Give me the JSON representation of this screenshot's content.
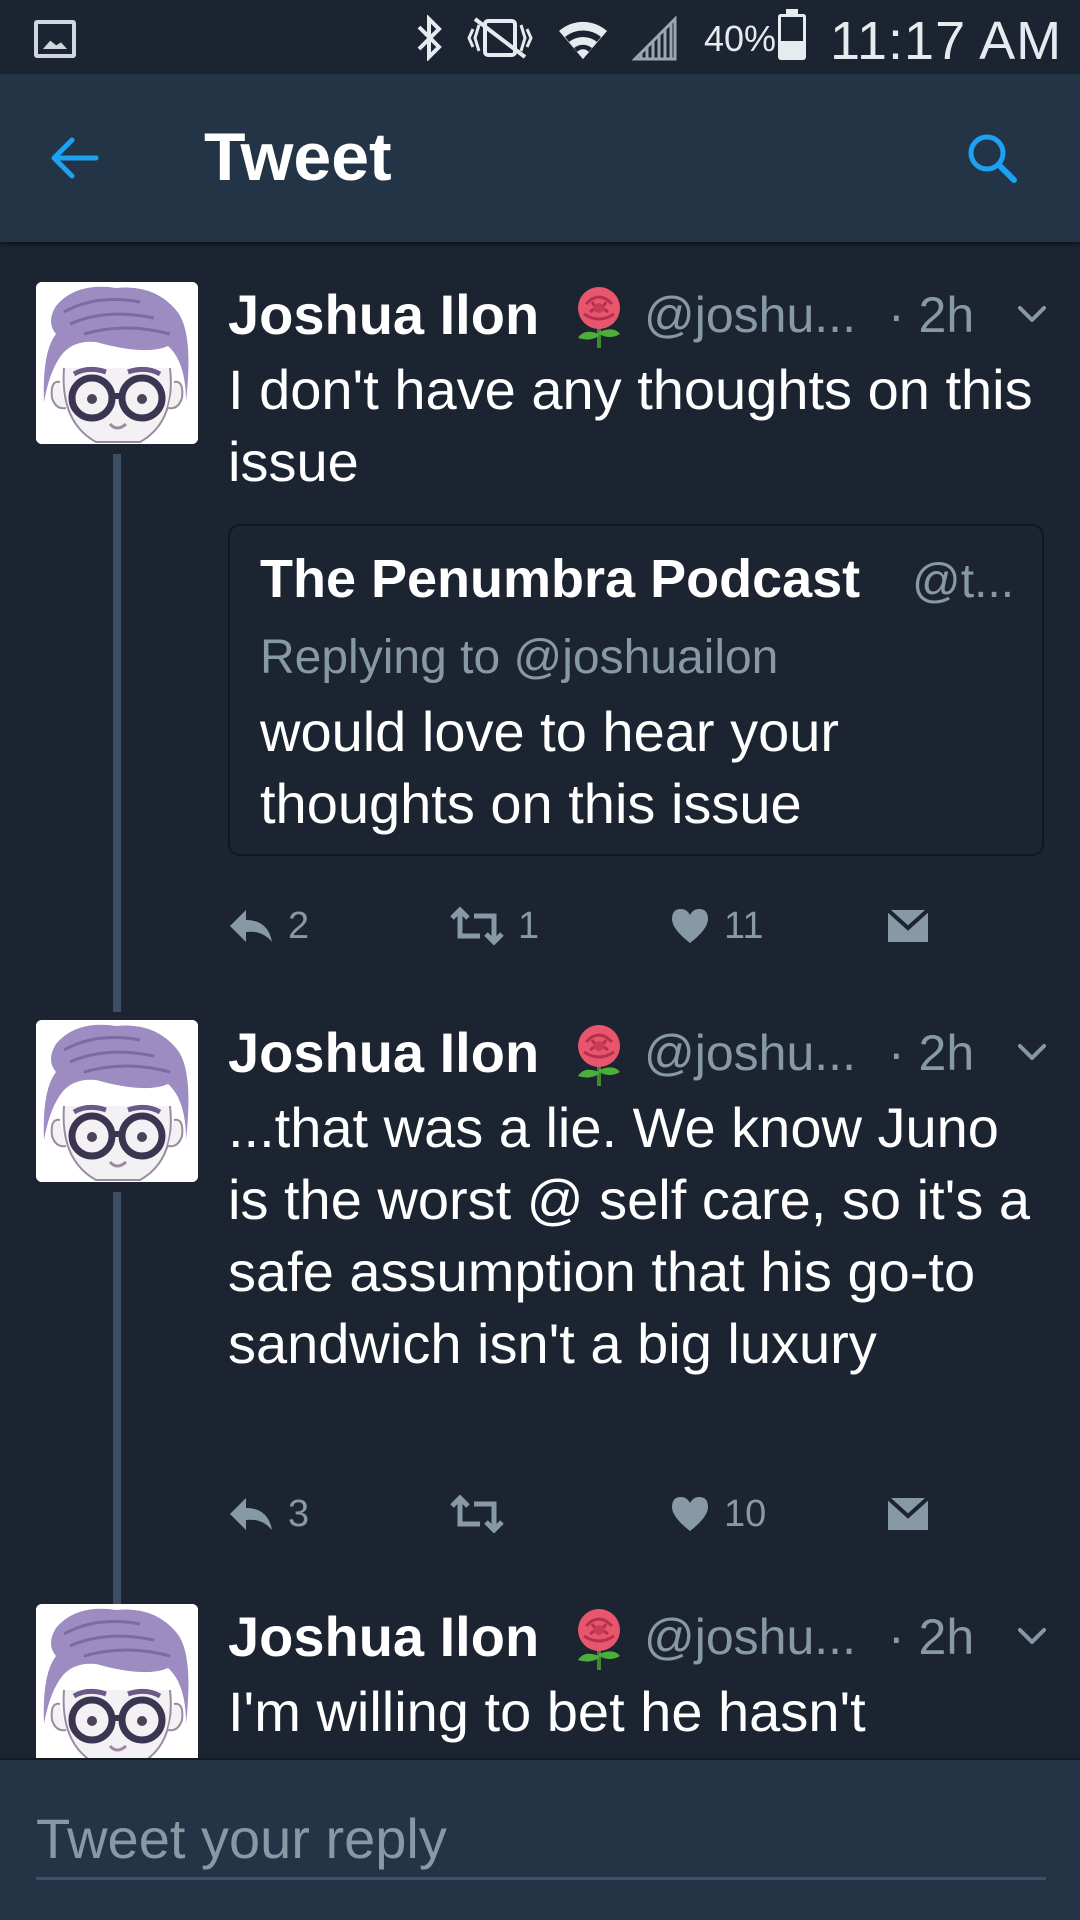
{
  "status_bar": {
    "battery": "40%",
    "time": "11:17 AM",
    "icons": [
      "gallery-icon",
      "bluetooth-icon",
      "vibrate-off-icon",
      "wifi-icon",
      "signal-icon",
      "battery-icon"
    ]
  },
  "header": {
    "title": "Tweet",
    "back_icon": "arrow-left-icon",
    "search_icon": "search-icon"
  },
  "tweets": [
    {
      "name": "Joshua Ilon",
      "handle": "@joshu...",
      "time": "· 2h",
      "text": "I don't have any thoughts on this issue",
      "quote": {
        "name": "The Penumbra Podcast",
        "handle": "@t...",
        "replying_to": "Replying to @joshuailon",
        "text": "would love to hear your thoughts on this issue"
      },
      "replies": "2",
      "retweets": "1",
      "likes": "11"
    },
    {
      "name": "Joshua Ilon",
      "handle": "@joshu...",
      "time": "· 2h",
      "text": "...that was a lie. We know Juno is the worst @ self care, so it's a safe assumption that his go-to sandwich isn't a big luxury",
      "replies": "3",
      "retweets": "",
      "likes": "10"
    },
    {
      "name": "Joshua Ilon",
      "handle": "@joshu...",
      "time": "· 2h",
      "text": "I'm willing to bet he hasn't"
    }
  ],
  "reply": {
    "placeholder": "Tweet your reply"
  },
  "colors": {
    "background": "#1b2430",
    "header": "#243447",
    "accent": "#1da1f2",
    "secondary_text": "#8899a6"
  }
}
